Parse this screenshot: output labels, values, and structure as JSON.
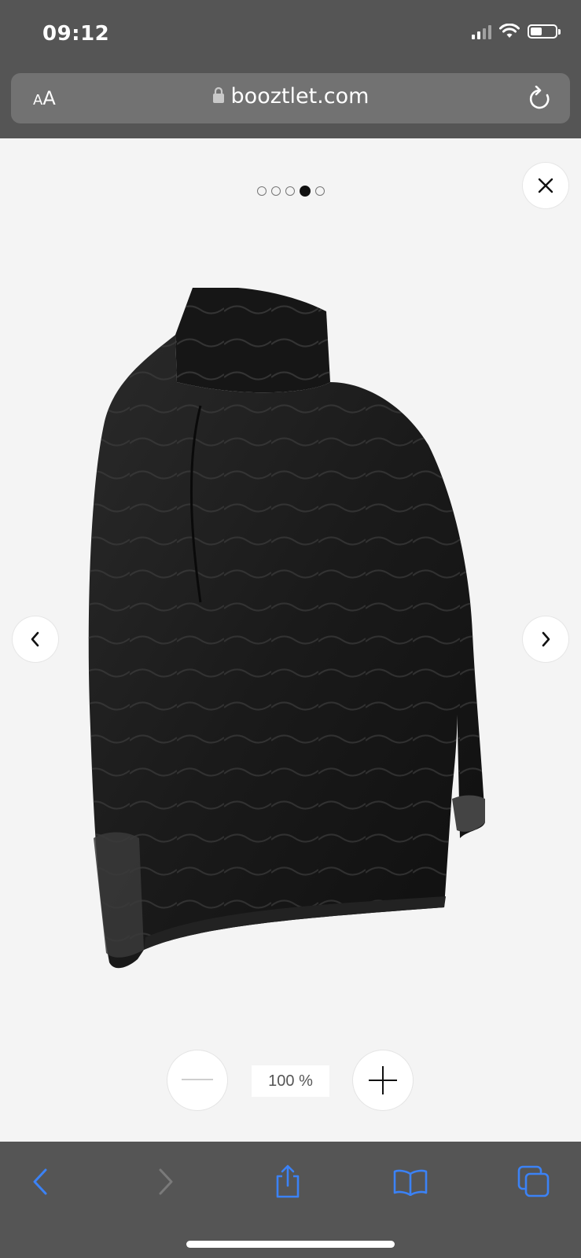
{
  "status_bar": {
    "time": "09:12",
    "icons": [
      "signal-icon",
      "wifi-icon",
      "battery-icon"
    ]
  },
  "browser": {
    "text_size_small": "A",
    "text_size_large": "A",
    "url": "booztlet.com",
    "icons": [
      "lock-icon",
      "reload-icon"
    ]
  },
  "gallery": {
    "slide_count": 5,
    "active_index": 3,
    "image_alt": "Black quilted high-neck pullover jacket",
    "icons": [
      "close-icon",
      "chevron-left-icon",
      "chevron-right-icon"
    ]
  },
  "zoom": {
    "level": "100 %",
    "icons": [
      "minus-icon",
      "plus-icon"
    ]
  },
  "toolbar": {
    "items": [
      "back-icon",
      "forward-icon",
      "share-icon",
      "bookmarks-icon",
      "tabs-icon"
    ],
    "accent": "#3b82f6",
    "disabled": "#7a7a7a"
  },
  "colors": {
    "chrome": "#555555",
    "url_bar": "#727272",
    "viewer_bg": "#f4f4f4"
  }
}
